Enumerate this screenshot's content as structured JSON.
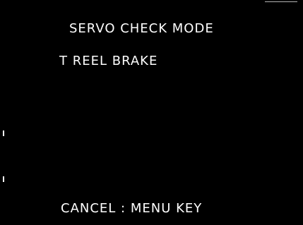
{
  "screen": {
    "title": "SERVO CHECK MODE",
    "item": "T REEL BRAKE",
    "footer": "CANCEL : MENU KEY",
    "background_color": "#000000",
    "text_color": "#ffffff"
  }
}
